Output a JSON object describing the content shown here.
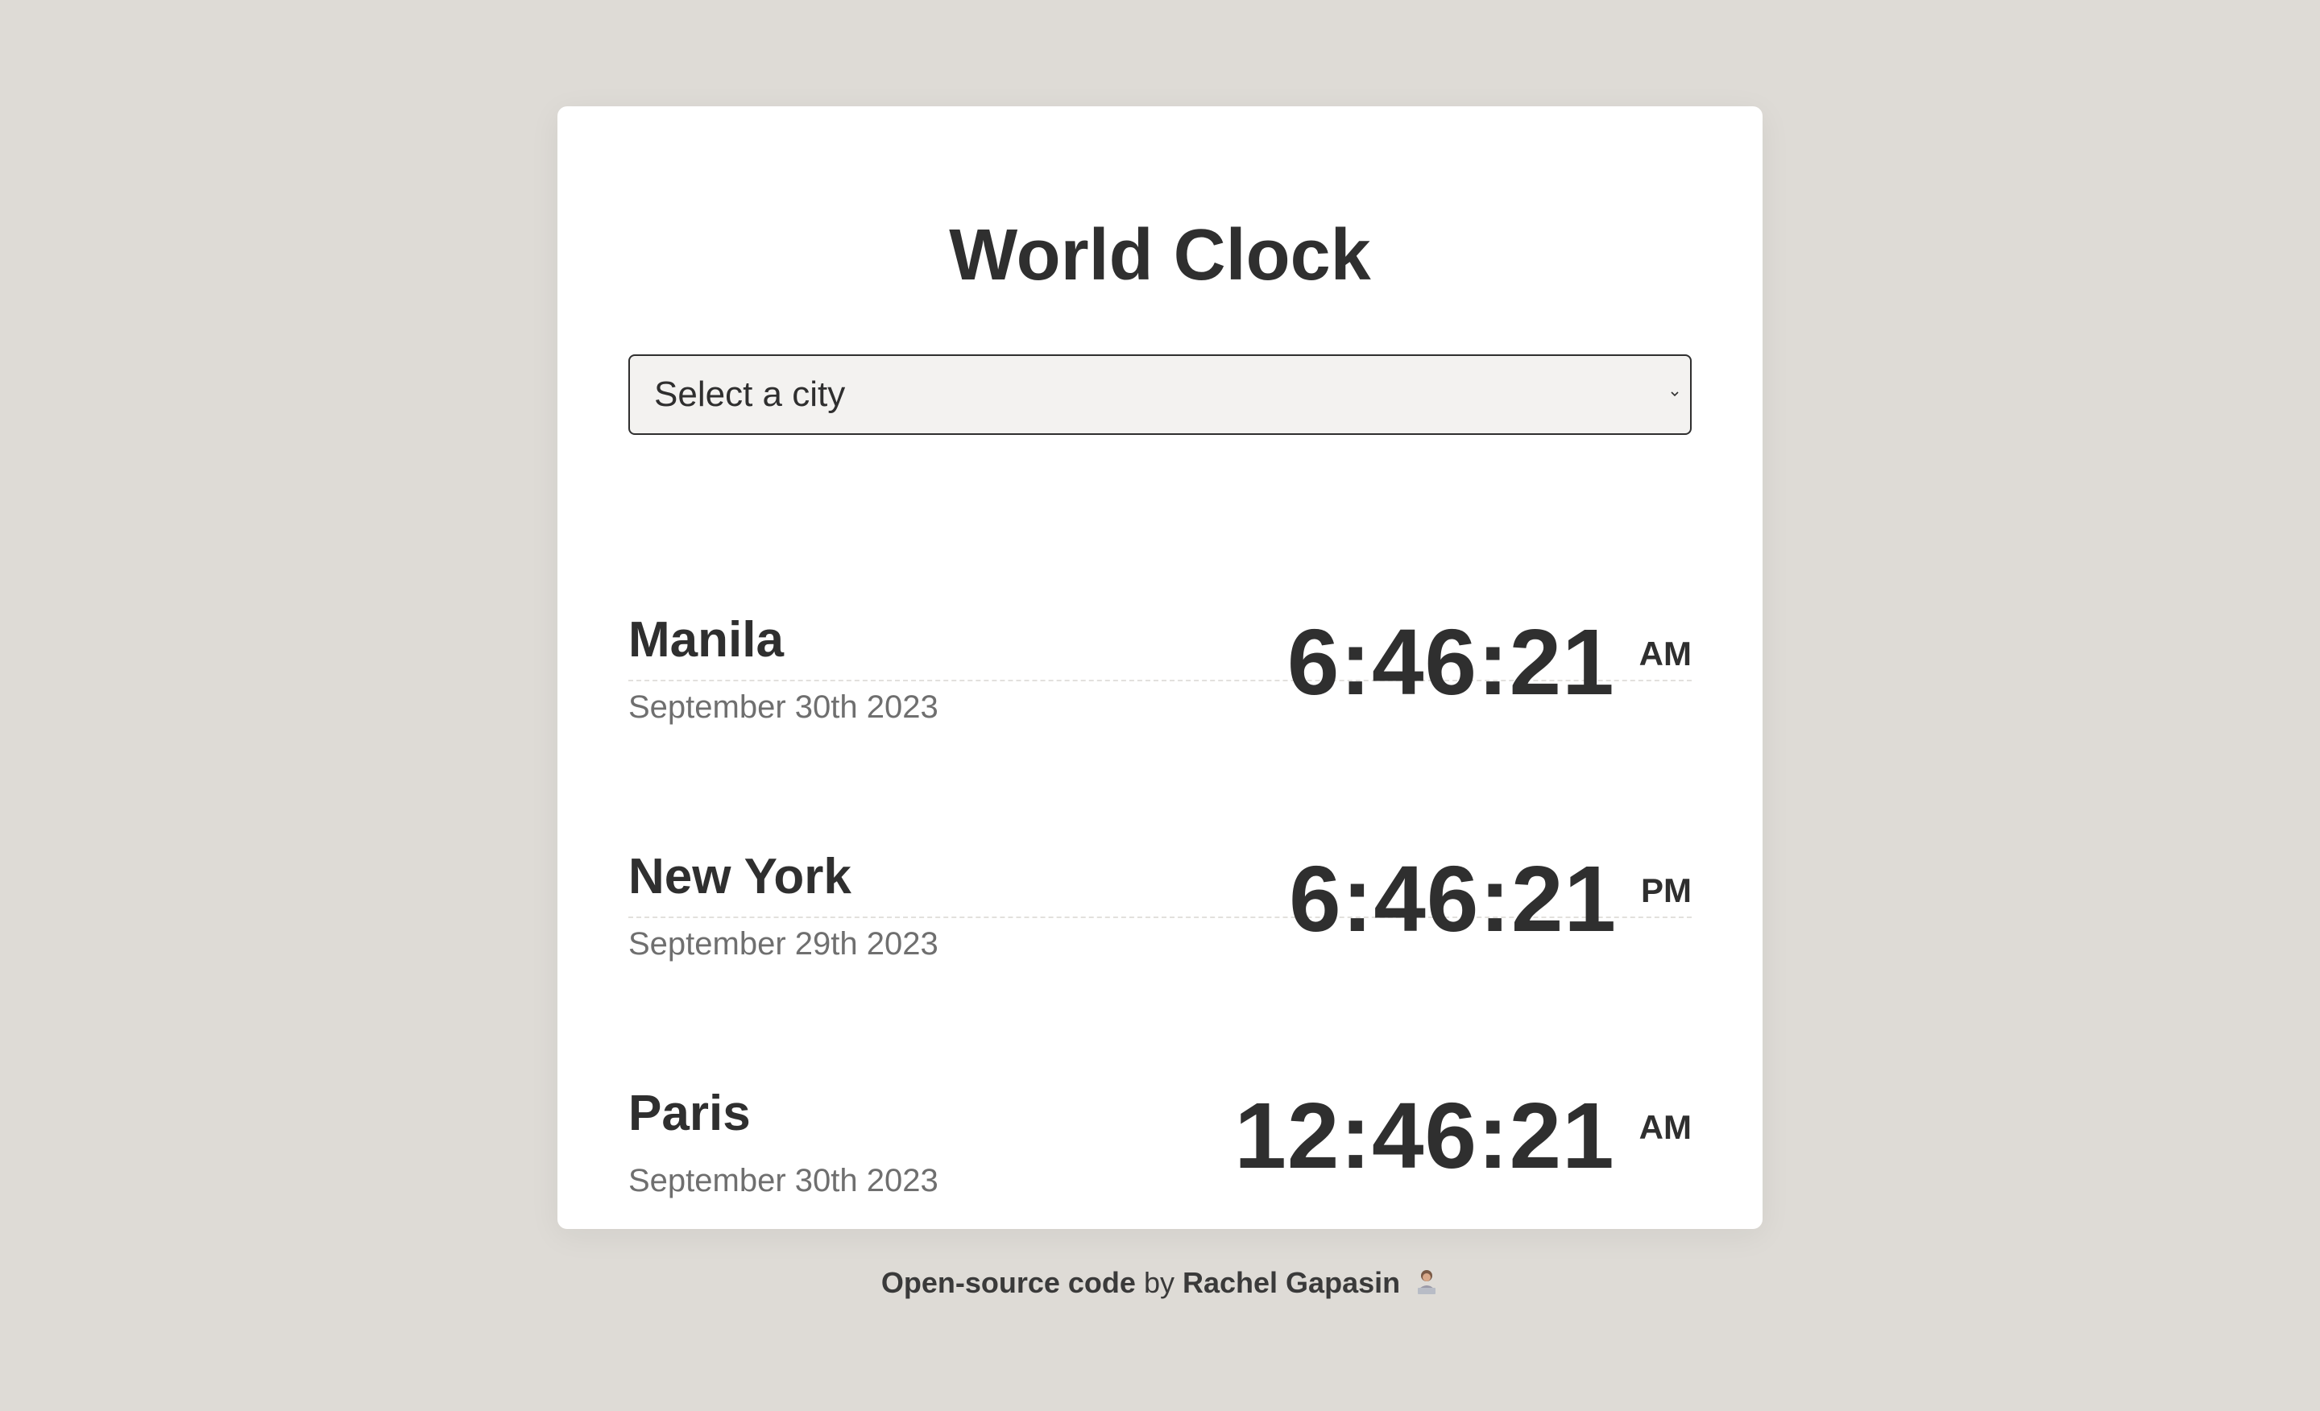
{
  "app": {
    "title": "World Clock"
  },
  "city_select": {
    "placeholder": "Select a city",
    "selected": "Select a city"
  },
  "cities": [
    {
      "name": "Manila",
      "date": "September 30th 2023",
      "time": "6:46:21",
      "ampm": "AM"
    },
    {
      "name": "New York",
      "date": "September 29th 2023",
      "time": "6:46:21",
      "ampm": "PM"
    },
    {
      "name": "Paris",
      "date": "September 30th 2023",
      "time": "12:46:21",
      "ampm": "AM"
    }
  ],
  "footer": {
    "code_link": "Open-source code",
    "by": "by",
    "author_link": "Rachel Gapasin",
    "emoji_icon": "person-at-laptop-emoji"
  },
  "colors": {
    "background": "#dedbd6",
    "card": "#ffffff",
    "text": "#2f2f2f",
    "muted": "#6f6f6f"
  }
}
